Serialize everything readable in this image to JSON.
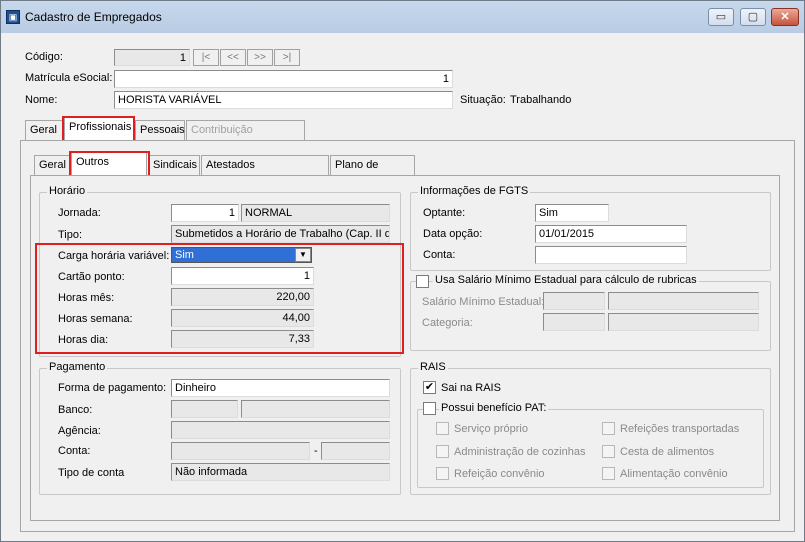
{
  "window": {
    "title": "Cadastro de Empregados",
    "app_icon": "app-icon",
    "minimize": "▭",
    "maximize": "▢",
    "close": "✕"
  },
  "header": {
    "codigo_label": "Código:",
    "codigo_value": "1",
    "nav": [
      "|<",
      "<<",
      ">>",
      ">|"
    ],
    "matricula_label": "Matrícula eSocial:",
    "matricula_value": "1",
    "nome_label": "Nome:",
    "nome_value": "HORISTA VARIÁVEL",
    "situacao_label": "Situação:",
    "situacao_value": "Trabalhando"
  },
  "main_tabs": [
    "Geral",
    "Profissionais",
    "Pessoais",
    "Contribuição Individual"
  ],
  "sub_tabs": [
    "Geral",
    "Outros Dados",
    "Sindicais",
    "Atestados Ocupacionais",
    "Plano de Saúde"
  ],
  "horario": {
    "title": "Horário",
    "jornada_label": "Jornada:",
    "jornada_code": "1",
    "jornada_desc": "NORMAL",
    "tipo_label": "Tipo:",
    "tipo_value": "Submetidos a Horário de Trabalho (Cap. II da C",
    "carga_label": "Carga horária variável:",
    "carga_value": "Sim",
    "cartao_label": "Cartão ponto:",
    "cartao_value": "1",
    "horas_mes_label": "Horas mês:",
    "horas_mes_value": "220,00",
    "horas_semana_label": "Horas semana:",
    "horas_semana_value": "44,00",
    "horas_dia_label": "Horas dia:",
    "horas_dia_value": "7,33"
  },
  "pagamento": {
    "title": "Pagamento",
    "forma_label": "Forma de pagamento:",
    "forma_value": "Dinheiro",
    "banco_label": "Banco:",
    "agencia_label": "Agência:",
    "conta_label": "Conta:",
    "conta_sep": "-",
    "tipo_conta_label": "Tipo de conta",
    "tipo_conta_value": "Não informada"
  },
  "fgts": {
    "title": "Informações de FGTS",
    "optante_label": "Optante:",
    "optante_value": "Sim",
    "data_opcao_label": "Data opção:",
    "data_opcao_value": "01/01/2015",
    "conta_label": "Conta:"
  },
  "salario": {
    "title": "Usa Salário Mínimo Estadual para cálculo de rubricas",
    "salario_label": "Salário Mínimo Estadual:",
    "categoria_label": "Categoria:"
  },
  "rais": {
    "title": "RAIS",
    "sai_na_rais": "Sai na RAIS",
    "sai_checked": "✔",
    "pat_title": "Possui benefício PAT:",
    "options_left": [
      "Serviço próprio",
      "Administração de cozinhas",
      "Refeição convênio"
    ],
    "options_right": [
      "Refeições transportadas",
      "Cesta de alimentos",
      "Alimentação convênio"
    ]
  }
}
